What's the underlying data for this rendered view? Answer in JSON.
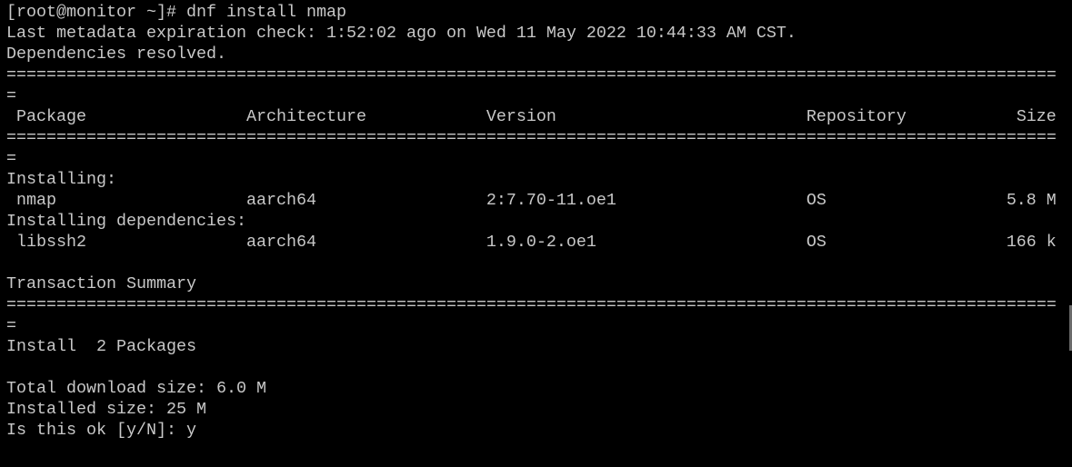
{
  "prompt": "[root@monitor ~]# dnf install nmap",
  "metadata_line": "Last metadata expiration check: 1:52:02 ago on Wed 11 May 2022 10:44:33 AM CST.",
  "resolved_line": "Dependencies resolved.",
  "separator": "=========================================================================================================",
  "separator_wrap": "=",
  "header": {
    "package": "Package",
    "architecture": "Architecture",
    "version": "Version",
    "repository": "Repository",
    "size": "Size"
  },
  "installing_label": "Installing:",
  "installing": [
    {
      "package": "nmap",
      "architecture": "aarch64",
      "version": "2:7.70-11.oe1",
      "repository": "OS",
      "size": "5.8 M"
    }
  ],
  "deps_label": "Installing dependencies:",
  "dependencies": [
    {
      "package": "libssh2",
      "architecture": "aarch64",
      "version": "1.9.0-2.oe1",
      "repository": "OS",
      "size": "166 k"
    }
  ],
  "summary_label": "Transaction Summary",
  "install_count": "Install  2 Packages",
  "total_download": "Total download size: 6.0 M",
  "installed_size": "Installed size: 25 M",
  "confirm_prompt": "Is this ok [y/N]: y"
}
